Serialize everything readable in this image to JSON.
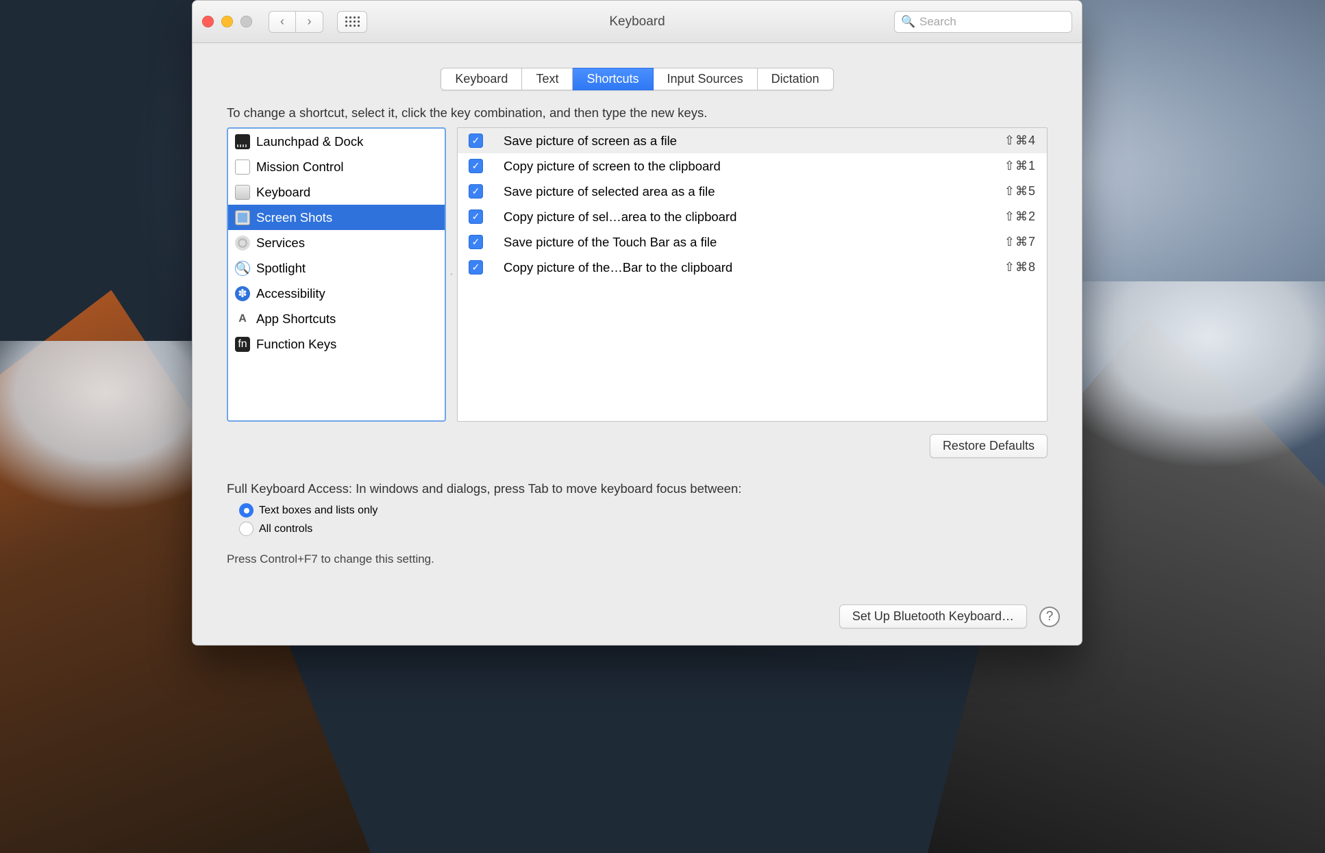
{
  "window": {
    "title": "Keyboard",
    "search_placeholder": "Search"
  },
  "tabs": [
    {
      "label": "Keyboard",
      "active": false
    },
    {
      "label": "Text",
      "active": false
    },
    {
      "label": "Shortcuts",
      "active": true
    },
    {
      "label": "Input Sources",
      "active": false
    },
    {
      "label": "Dictation",
      "active": false
    }
  ],
  "instruction": "To change a shortcut, select it, click the key combination, and then type the new keys.",
  "categories": [
    {
      "icon": "launchpad-dock-icon",
      "label": "Launchpad & Dock",
      "selected": false
    },
    {
      "icon": "mission-control-icon",
      "label": "Mission Control",
      "selected": false
    },
    {
      "icon": "keyboard-icon",
      "label": "Keyboard",
      "selected": false
    },
    {
      "icon": "screen-shots-icon",
      "label": "Screen Shots",
      "selected": true
    },
    {
      "icon": "services-icon",
      "label": "Services",
      "selected": false
    },
    {
      "icon": "spotlight-icon",
      "label": "Spotlight",
      "selected": false
    },
    {
      "icon": "accessibility-icon",
      "label": "Accessibility",
      "selected": false
    },
    {
      "icon": "app-shortcuts-icon",
      "label": "App Shortcuts",
      "selected": false
    },
    {
      "icon": "function-keys-icon",
      "label": "Function Keys",
      "selected": false
    }
  ],
  "shortcuts": [
    {
      "checked": true,
      "selected": true,
      "desc": "Save picture of screen as a file",
      "keys": "⇧⌘4"
    },
    {
      "checked": true,
      "selected": false,
      "desc": "Copy picture of screen to the clipboard",
      "keys": "⇧⌘1"
    },
    {
      "checked": true,
      "selected": false,
      "desc": "Save picture of selected area as a file",
      "keys": "⇧⌘5"
    },
    {
      "checked": true,
      "selected": false,
      "desc": "Copy picture of sel…area to the clipboard",
      "keys": "⇧⌘2"
    },
    {
      "checked": true,
      "selected": false,
      "desc": "Save picture of the Touch Bar as a file",
      "keys": "⇧⌘7"
    },
    {
      "checked": true,
      "selected": false,
      "desc": "Copy picture of the…Bar to the clipboard",
      "keys": "⇧⌘8"
    }
  ],
  "restore_defaults": "Restore Defaults",
  "fka": {
    "label": "Full Keyboard Access: In windows and dialogs, press Tab to move keyboard focus between:",
    "options": [
      {
        "label": "Text boxes and lists only",
        "checked": true
      },
      {
        "label": "All controls",
        "checked": false
      }
    ],
    "hint": "Press Control+F7 to change this setting."
  },
  "footer": {
    "bluetooth_button": "Set Up Bluetooth Keyboard…"
  },
  "icons": {
    "spotlight_glyph": "🔍",
    "accessibility_glyph": "✽",
    "fn_glyph": "fn"
  }
}
